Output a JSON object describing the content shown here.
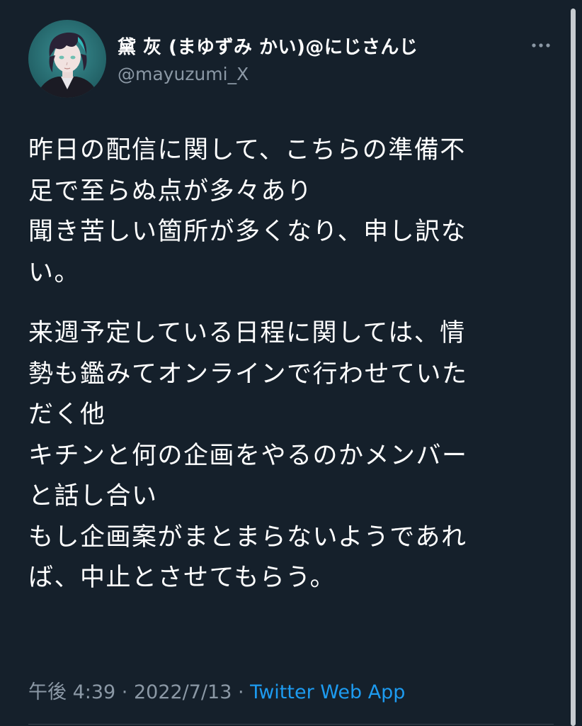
{
  "author": {
    "display_name": "黛 灰 (まゆずみ かい)@にじさんじ",
    "handle": "@mayuzumi_X"
  },
  "tweet": {
    "paragraphs": [
      {
        "lines": [
          "昨日の配信に関して、こちらの準備不",
          "足で至らぬ点が多々あり",
          "聞き苦しい箇所が多くなり、申し訳な",
          "い。"
        ]
      },
      {
        "lines": [
          "来週予定している日程に関しては、情",
          "勢も鑑みてオンラインで行わせていた",
          "だく他",
          "キチンと何の企画をやるのかメンバー",
          "と話し合い",
          "もし企画案がまとまらないようであれ",
          "ば、中止とさせてもらう。"
        ]
      }
    ],
    "time": "午後 4:39",
    "separator": " · ",
    "date": "2022/7/13",
    "source": "Twitter Web App"
  },
  "icons": {
    "more": "more-horizontal-icon",
    "avatar": "user-avatar"
  },
  "colors": {
    "background": "#15202b",
    "text_primary": "#ffffff",
    "text_secondary": "#8b98a5",
    "link": "#1d9bf0",
    "divider": "#38444d"
  }
}
